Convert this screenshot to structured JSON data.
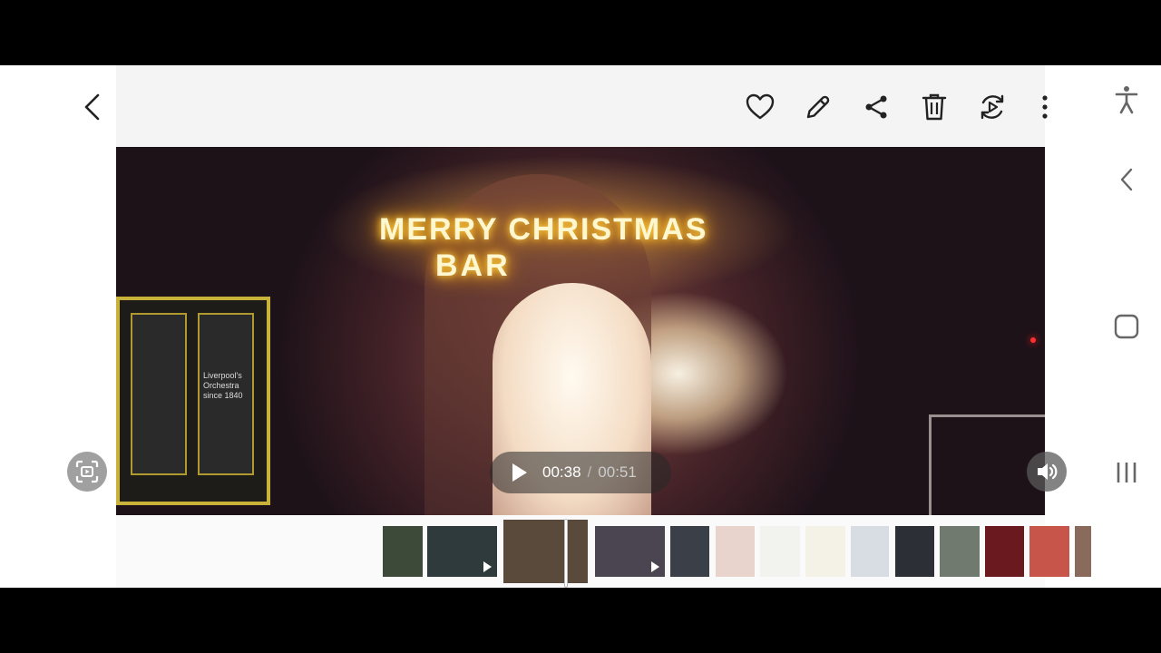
{
  "player": {
    "current_time": "00:38",
    "separator": "/",
    "total_time": "00:51"
  },
  "video_scene": {
    "sign_line1": "MERRY CHRISTMAS",
    "sign_line2": "BAR",
    "crate_text": "Liverpool's Orchestra since 1840"
  },
  "icons": {
    "back": "back-arrow-icon",
    "favorite": "heart-icon",
    "edit": "pencil-icon",
    "share": "share-icon",
    "delete": "trash-icon",
    "remaster": "remaster-icon",
    "more": "more-vertical-icon",
    "capture": "capture-icon",
    "volume": "volume-icon",
    "accessibility": "accessibility-icon",
    "nav_back": "nav-back-icon",
    "nav_home": "nav-home-icon",
    "nav_recents": "nav-recents-icon"
  },
  "thumbnails": [
    {
      "type": "image",
      "color": "#3d4a3a"
    },
    {
      "type": "video",
      "color": "#2e3a3c"
    },
    {
      "type": "video-current",
      "color": "#5a4a3c"
    },
    {
      "type": "video",
      "color": "#4a4550"
    },
    {
      "type": "image",
      "color": "#3a3f48"
    },
    {
      "type": "image",
      "color": "#e8d4cc"
    },
    {
      "type": "image",
      "color": "#f2f2ee"
    },
    {
      "type": "image",
      "color": "#f4f2e6"
    },
    {
      "type": "image",
      "color": "#d8dde4"
    },
    {
      "type": "image",
      "color": "#2c3036"
    },
    {
      "type": "image",
      "color": "#707a6e"
    },
    {
      "type": "image",
      "color": "#6a1a1e"
    },
    {
      "type": "image",
      "color": "#c8554a"
    },
    {
      "type": "image",
      "color": "#8a6a5a"
    }
  ],
  "colors": {
    "icon": "#222222",
    "navbar_icon": "#666666"
  }
}
